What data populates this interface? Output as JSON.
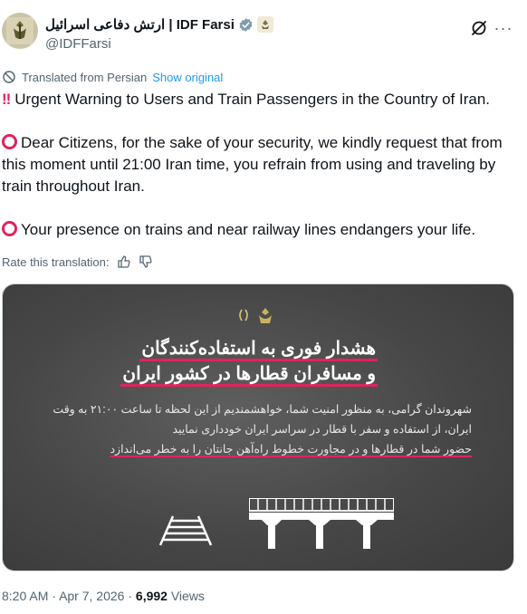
{
  "account": {
    "name": "ارتش دفاعی اسرائیل | IDF Farsi",
    "handle": "@IDFFarsi"
  },
  "translation": {
    "label": "Translated from Persian",
    "show_original": "Show original",
    "rate_label": "Rate this translation:"
  },
  "tweet": {
    "p1": "Urgent Warning to Users and Train Passengers in the Country of Iran.",
    "p2": "Dear Citizens, for the sake of your security, we kindly request that from this moment until 21:00 Iran time, you refrain from using and traveling by train throughout Iran.",
    "p3": "Your presence on trains and near railway lines endangers your life."
  },
  "media": {
    "headline_line1": "هشدار فوری به استفاده‌کنندگان",
    "headline_line2": "و مسافران قطارها در کشور ایران",
    "body_line1": "شهروندان گرامی، به منظور امنیت شما، خواهشمندیم از این لحظه تا ساعت ۲۱:۰۰ به وقت",
    "body_line2": "ایران، از استفاده و سفر با قطار در سراسر ایران خودداری نمایید",
    "body_line3": "حضور شما در قطارها و در مجاورت خطوط راه‌آهن جانتان را به خطر می‌اندازد"
  },
  "meta": {
    "time": "8:20 AM",
    "sep1": "·",
    "date": "Apr 7, 2026",
    "sep2": "·",
    "views_count": "6,992",
    "views_label": "Views"
  },
  "colors": {
    "accent_red": "#e0245e",
    "link_blue": "#1d9bf0",
    "muted": "#536471"
  },
  "icons": [
    "idf-emblem-icon",
    "verified-badge-icon",
    "affiliate-badge-icon",
    "grok-icon",
    "more-icon",
    "translate-icon",
    "thumbs-up-icon",
    "thumbs-down-icon",
    "railway-track-icon",
    "bridge-icon"
  ]
}
